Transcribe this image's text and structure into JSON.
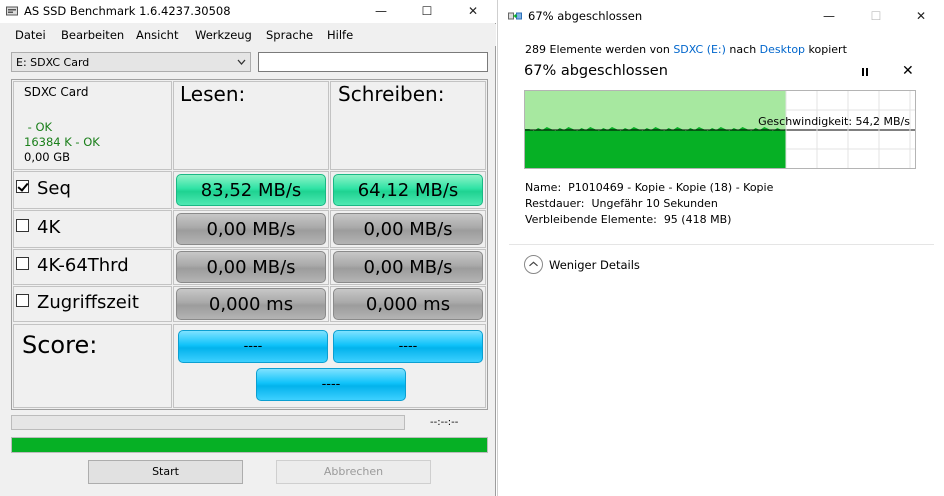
{
  "asssd": {
    "title": "AS SSD Benchmark 1.6.4237.30508",
    "window_controls": {
      "minimize": "—",
      "maximize": "☐",
      "close": "✕"
    },
    "menu": [
      "Datei",
      "Bearbeiten",
      "Ansicht",
      "Werkzeug",
      "Sprache",
      "Hilfe"
    ],
    "drive_select": "E: SDXC Card",
    "drive_text": "",
    "info": {
      "name": "SDXC Card",
      "line1": " - OK",
      "line2": "16384 K - OK",
      "size": "0,00 GB"
    },
    "columns": {
      "read": "Lesen:",
      "write": "Schreiben:"
    },
    "rows": [
      {
        "label": "Seq",
        "checked": true,
        "read": "83,52 MB/s",
        "write": "64,12 MB/s",
        "state": "done"
      },
      {
        "label": "4K",
        "checked": false,
        "read": "0,00 MB/s",
        "write": "0,00 MB/s",
        "state": "idle"
      },
      {
        "label": "4K-64Thrd",
        "checked": false,
        "read": "0,00 MB/s",
        "write": "0,00 MB/s",
        "state": "idle"
      },
      {
        "label": "Zugriffszeit",
        "checked": false,
        "read": "0,000 ms",
        "write": "0,000 ms",
        "state": "idle"
      }
    ],
    "score": {
      "label": "Score:",
      "read": "----",
      "write": "----",
      "total": "----"
    },
    "time_readout": "--:--:--",
    "overall_progress": 1.0,
    "buttons": {
      "start": "Start",
      "abort": "Abbrechen"
    }
  },
  "copy_dialog": {
    "title": "67% abgeschlossen",
    "window_controls": {
      "minimize": "—",
      "maximize": "☐",
      "close": "✕"
    },
    "summary": {
      "prefix": "289 Elemente werden von ",
      "source": "SDXC (E:)",
      "middle": " nach ",
      "dest": "Desktop",
      "suffix": " kopiert"
    },
    "percent_text": "67% abgeschlossen",
    "progress": 0.67,
    "speed_text": "Geschwindigkeit: 54,2 MB/s",
    "details": [
      {
        "label": "Name:",
        "value": "P1010469 - Kopie - Kopie (18) - Kopie"
      },
      {
        "label": "Restdauer:",
        "value": "Ungefähr 10 Sekunden"
      },
      {
        "label": "Verbleibende Elemente:",
        "value": "95 (418 MB)"
      }
    ],
    "toggle_label": "Weniger Details",
    "colors": {
      "graph_fill": "#06b025",
      "graph_bg": "#a7e8a0",
      "link": "#0066cc"
    }
  }
}
